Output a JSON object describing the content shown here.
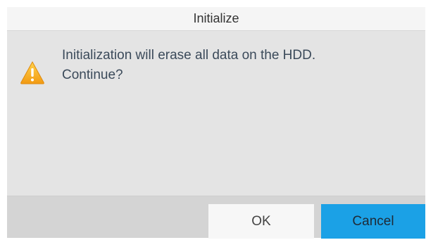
{
  "dialog": {
    "title": "Initialize",
    "message_line1": "Initialization will erase all data on the HDD.",
    "message_line2": "Continue?",
    "icon": "warning-triangle-icon"
  },
  "buttons": {
    "ok_label": "OK",
    "cancel_label": "Cancel"
  },
  "colors": {
    "primary_button": "#1ba1e6",
    "warning_icon": "#f5a623"
  }
}
